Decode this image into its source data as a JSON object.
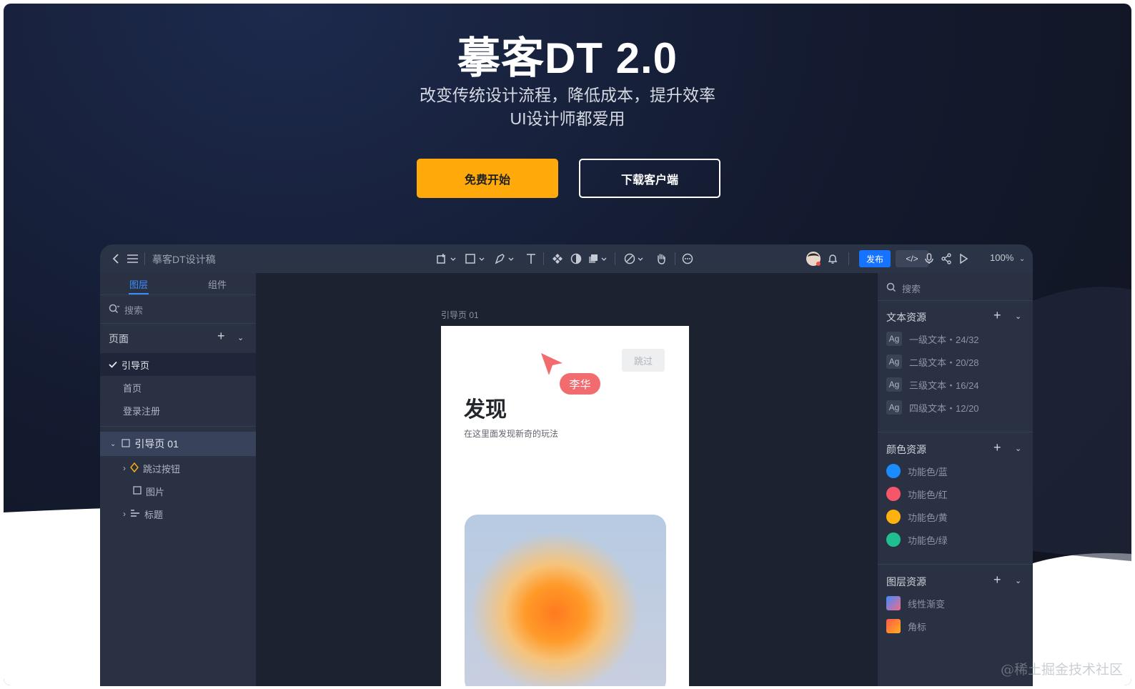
{
  "hero": {
    "title": "摹客DT 2.0",
    "subtitle_line1": "改变传统设计流程，降低成本，提升效率",
    "subtitle_line2": "UI设计师都爱用",
    "primary_button": "免费开始",
    "secondary_button": "下载客户端"
  },
  "colors": {
    "primary": "#ffa90a",
    "publish_blue": "#1673ff",
    "accent_blue": "#3d8bff"
  },
  "toolbar": {
    "file_title": "摹客DT设计稿",
    "publish_label": "发布",
    "code_label": "</>",
    "zoom_label": "100%",
    "icons": [
      "back-icon",
      "menu-icon",
      "frame-tool-icon",
      "rectangle-tool-icon",
      "pen-tool-icon",
      "text-tool-icon",
      "component-icon",
      "mask-icon",
      "boolean-icon",
      "prototype-icon",
      "hand-tool-icon",
      "comment-icon",
      "avatar",
      "bell-icon",
      "mic-icon",
      "share-icon",
      "play-icon"
    ]
  },
  "left_panel": {
    "tab_layers": "图层",
    "tab_components": "组件",
    "search_placeholder": "搜索",
    "pages_header": "页面",
    "pages": [
      "引导页",
      "首页",
      "登录注册"
    ],
    "frame_name": "引导页 01",
    "layers": [
      "跳过按钮",
      "图片",
      "标题"
    ]
  },
  "canvas": {
    "frame_label": "引导页 01",
    "skip_label": "跳过",
    "discover_title": "发现",
    "discover_subtitle": "在这里面发现新奇的玩法",
    "cursor_user": "李华"
  },
  "right_panel": {
    "search_placeholder": "搜索",
    "text_header": "文本资源",
    "text_styles": [
      {
        "badge": "Ag",
        "label": "一级文本・24/32"
      },
      {
        "badge": "Ag",
        "label": "二级文本・20/28"
      },
      {
        "badge": "Ag",
        "label": "三级文本・16/24"
      },
      {
        "badge": "Ag",
        "label": "四级文本・12/20"
      }
    ],
    "color_header": "颜色资源",
    "color_styles": [
      {
        "label": "功能色/蓝",
        "color": "#1a8cff"
      },
      {
        "label": "功能色/红",
        "color": "#f5566a"
      },
      {
        "label": "功能色/黄",
        "color": "#ffb20f"
      },
      {
        "label": "功能色/绿",
        "color": "#1fbf8f"
      }
    ],
    "layer_header": "图层资源",
    "layer_styles": [
      "线性渐变",
      "角标"
    ]
  },
  "watermark": "@稀土掘金技术社区"
}
